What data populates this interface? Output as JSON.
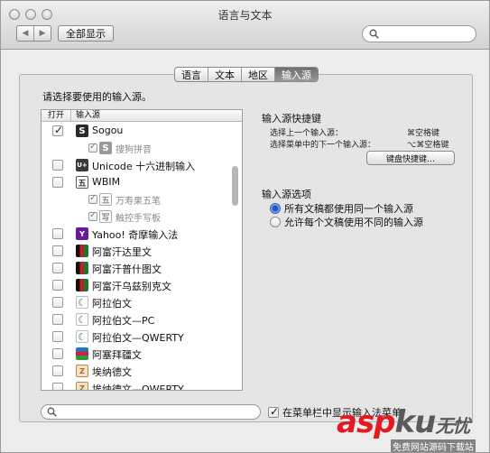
{
  "window": {
    "title": "语言与文本"
  },
  "toolbar": {
    "back_label": "◀",
    "forward_label": "▶",
    "show_all": "全部显示",
    "search_value": ""
  },
  "tabs": [
    {
      "label": "语言",
      "active": false
    },
    {
      "label": "文本",
      "active": false
    },
    {
      "label": "地区",
      "active": false
    },
    {
      "label": "输入源",
      "active": true
    }
  ],
  "input_sources": {
    "heading": "请选择要使用的输入源。",
    "col_enable": "打开",
    "col_source": "输入源",
    "items": [
      {
        "label": "Sogou",
        "checked": true,
        "sub": false,
        "icon": "sogou-icon",
        "icon_text": "S",
        "color": "#2a2a2a"
      },
      {
        "label": "搜狗拼音",
        "checked": true,
        "sub": true,
        "icon": "sogou-pinyin-icon",
        "icon_text": "S",
        "color": "#9a9a9a"
      },
      {
        "label": "Unicode 十六进制输入",
        "checked": false,
        "sub": false,
        "icon": "unicode-icon",
        "icon_text": "U+",
        "color": "#3a3a3a"
      },
      {
        "label": "WBIM",
        "checked": false,
        "sub": false,
        "icon": "wbim-icon",
        "icon_text": "五",
        "color": "#ffffff"
      },
      {
        "label": "万寿果五笔",
        "checked": true,
        "sub": true,
        "icon": "wubi-icon",
        "icon_text": "五",
        "color": "#ffffff"
      },
      {
        "label": "触控手写板",
        "checked": true,
        "sub": true,
        "icon": "handwriting-icon",
        "icon_text": "写",
        "color": "#ffffff"
      },
      {
        "label": "Yahoo! 奇摩输入法",
        "checked": false,
        "sub": false,
        "icon": "yahoo-icon",
        "icon_text": "Y",
        "color": "#6a1b9a"
      },
      {
        "label": "阿富汗达里文",
        "checked": false,
        "sub": false,
        "icon": "flag-afghanistan-icon",
        "icon_text": "",
        "color": "#1a7a2a"
      },
      {
        "label": "阿富汗普什图文",
        "checked": false,
        "sub": false,
        "icon": "flag-afghanistan-icon",
        "icon_text": "",
        "color": "#1a7a2a"
      },
      {
        "label": "阿富汗乌兹别克文",
        "checked": false,
        "sub": false,
        "icon": "flag-afghanistan-icon",
        "icon_text": "",
        "color": "#1a7a2a"
      },
      {
        "label": "阿拉伯文",
        "checked": false,
        "sub": false,
        "icon": "crescent-icon",
        "icon_text": "☾",
        "color": "#2e7d32"
      },
      {
        "label": "阿拉伯文—PC",
        "checked": false,
        "sub": false,
        "icon": "crescent-pc-icon",
        "icon_text": "☾",
        "color": "#2e7d32"
      },
      {
        "label": "阿拉伯文—QWERTY",
        "checked": false,
        "sub": false,
        "icon": "crescent-qwerty-icon",
        "icon_text": "☾",
        "color": "#2e7d32"
      },
      {
        "label": "阿塞拜疆文",
        "checked": false,
        "sub": false,
        "icon": "flag-azerbaijan-icon",
        "icon_text": "",
        "color": "#1b78c8"
      },
      {
        "label": "埃纳德文",
        "checked": false,
        "sub": false,
        "icon": "script-icon",
        "icon_text": "Z",
        "color": "#a0692b"
      },
      {
        "label": "埃纳德文—QWERTY",
        "checked": false,
        "sub": false,
        "icon": "script-qwerty-icon",
        "icon_text": "Z",
        "color": "#a0692b"
      }
    ]
  },
  "shortcuts": {
    "title": "输入源快捷键",
    "prev_label": "选择上一个输入源：",
    "prev_key": "⌘空格键",
    "next_label": "选择菜单中的下一个输入源：",
    "next_key": "⌥⌘空格键",
    "button": "键盘快捷键…"
  },
  "options": {
    "title": "输入源选项",
    "same": "所有文稿都使用同一个输入源",
    "different": "允许每个文稿使用不同的输入源",
    "selected": "same"
  },
  "bottom": {
    "search_value": "",
    "show_menu_label": "在菜单栏中显示输入法菜单",
    "show_menu_checked": true
  },
  "watermark": {
    "brand_a": "asp",
    "brand_b": "ku",
    "tail": "无忧",
    "sub": "免费网站源码下载站"
  }
}
